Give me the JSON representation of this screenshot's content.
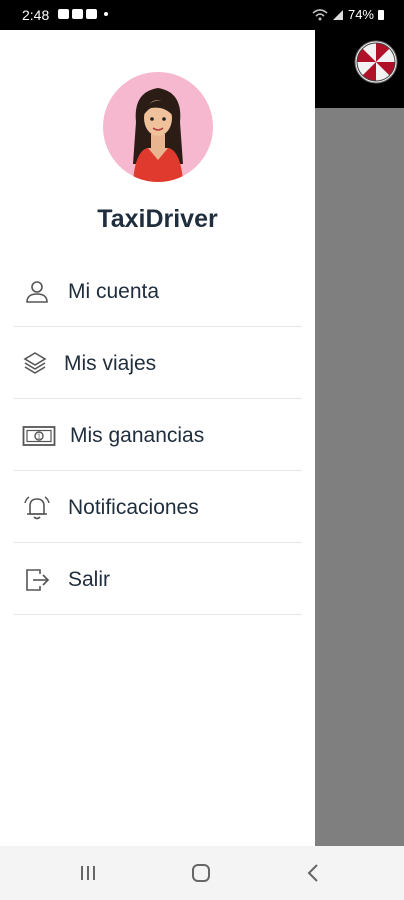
{
  "status_bar": {
    "time": "2:48",
    "battery": "74%",
    "icons": [
      "gallery-icon",
      "youtube-icon",
      "youtube-icon",
      "dot-icon",
      "wifi-icon",
      "signal-icon",
      "battery-icon"
    ]
  },
  "drawer": {
    "app_name": "TaxiDriver",
    "avatar": "woman-avatar",
    "items": [
      {
        "label": "Mi cuenta",
        "icon": "user-icon"
      },
      {
        "label": "Mis viajes",
        "icon": "layers-icon"
      },
      {
        "label": "Mis ganancias",
        "icon": "money-icon"
      },
      {
        "label": "Notificaciones",
        "icon": "bell-icon"
      },
      {
        "label": "Salir",
        "icon": "logout-icon"
      }
    ]
  },
  "nav_bar": {
    "buttons": [
      "recents-icon",
      "home-icon",
      "back-icon"
    ]
  },
  "colors": {
    "text": "#1f2d3d",
    "avatar_bg": "#f6b8cf",
    "scrim": "#7f7f7f",
    "umbrella_red": "#b01028"
  }
}
